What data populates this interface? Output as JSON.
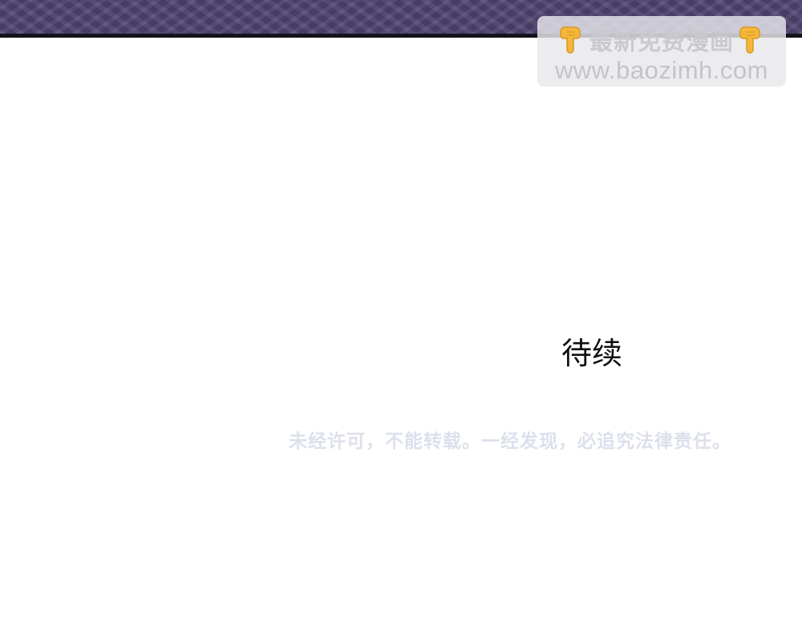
{
  "banner": {
    "color": "#4f4470",
    "edge_color": "#15121d"
  },
  "watermark": {
    "title": "最新免费漫画",
    "url": "www.baozimh.com",
    "left_icon": "pointing-down-hand-icon",
    "right_icon": "pointing-down-hand-icon",
    "icon_color": "#f5b73a"
  },
  "content": {
    "to_be_continued": "待续",
    "copyright_notice": "未经许可，不能转载。一经发现，必追究法律责任。"
  }
}
